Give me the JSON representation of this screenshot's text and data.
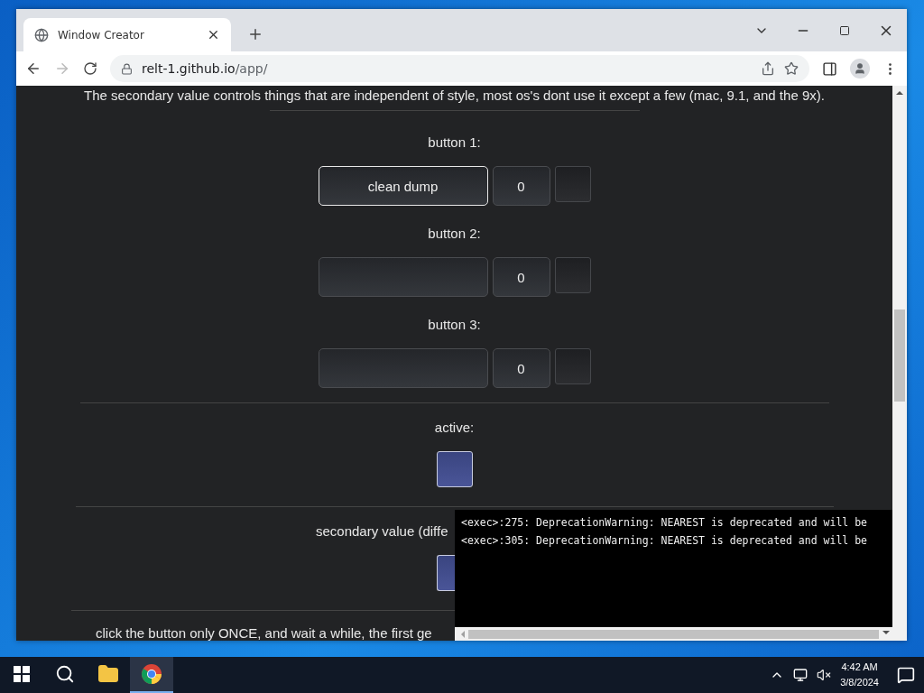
{
  "browser": {
    "tab_title": "Window Creator",
    "url_host": "relt-1.github.io",
    "url_path": "/app/"
  },
  "page": {
    "intro": "The secondary value controls things that are independent of style, most os's dont use it except a few (mac, 9.1, and the 9x).",
    "buttons": [
      {
        "label": "button 1:",
        "value": "clean dump",
        "number": "0",
        "checked": false,
        "focused": true
      },
      {
        "label": "button 2:",
        "number": "0",
        "checked": false,
        "focused": false
      },
      {
        "label": "button 3:",
        "number": "0",
        "checked": false,
        "focused": false
      }
    ],
    "active": {
      "label": "active:",
      "checked": true
    },
    "secondary": {
      "label": "secondary value (diffe",
      "checked": true
    },
    "note": "click the button only ONCE, and wait a while, the first ge"
  },
  "console": {
    "lines": [
      "<exec>:275: DeprecationWarning: NEAREST is deprecated and will be",
      "<exec>:305: DeprecationWarning: NEAREST is deprecated and will be"
    ]
  },
  "taskbar": {
    "apps": [
      {
        "kind": "explorer",
        "selected": false
      },
      {
        "kind": "chrome",
        "selected": true
      }
    ],
    "time": "4:42 AM",
    "date": "3/8/2024"
  }
}
